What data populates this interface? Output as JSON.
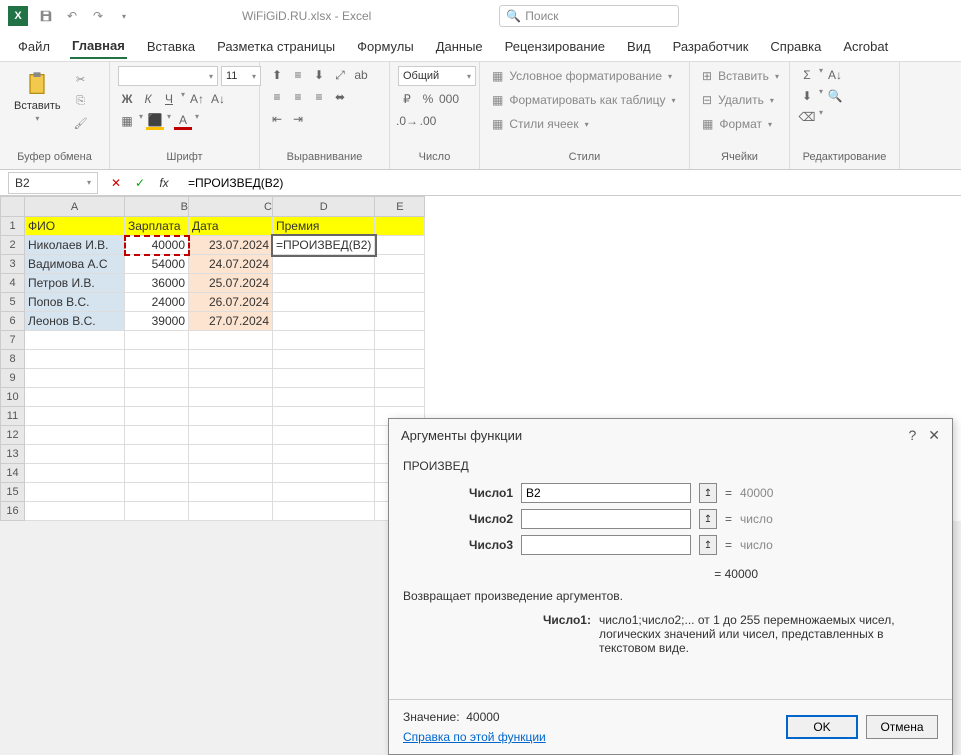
{
  "app": {
    "title": "WiFiGiD.RU.xlsx - Excel",
    "icon_letter": "X",
    "search_placeholder": "Поиск"
  },
  "menu": {
    "file": "Файл",
    "home": "Главная",
    "insert": "Вставка",
    "layout": "Разметка страницы",
    "formulas": "Формулы",
    "data": "Данные",
    "review": "Рецензирование",
    "view": "Вид",
    "developer": "Разработчик",
    "help": "Справка",
    "acrobat": "Acrobat"
  },
  "ribbon": {
    "paste": "Вставить",
    "clipboard_label": "Буфер обмена",
    "font_label": "Шрифт",
    "align_label": "Выравнивание",
    "number_label": "Число",
    "styles_label": "Стили",
    "cells_label": "Ячейки",
    "editing_label": "Редактирование",
    "font_size": "11",
    "number_format": "Общий",
    "cond_format": "Условное форматирование",
    "as_table": "Форматировать как таблицу",
    "cell_styles": "Стили ячеек",
    "insert_cells": "Вставить",
    "delete_cells": "Удалить",
    "format_cells": "Формат"
  },
  "formula_bar": {
    "name_box": "B2",
    "formula": "=ПРОИЗВЕД(B2)"
  },
  "columns": [
    "A",
    "B",
    "C",
    "D",
    "E"
  ],
  "headers": {
    "fio": "ФИО",
    "salary": "Зарплата",
    "date": "Дата",
    "bonus": "Премия"
  },
  "rows": [
    {
      "n": "Николаев И.В.",
      "s": "40000",
      "d": "23.07.2024",
      "b": "=ПРОИЗВЕД(B2)"
    },
    {
      "n": "Вадимова А.С",
      "s": "54000",
      "d": "24.07.2024",
      "b": ""
    },
    {
      "n": "Петров И.В.",
      "s": "36000",
      "d": "25.07.2024",
      "b": ""
    },
    {
      "n": "Попов В.С.",
      "s": "24000",
      "d": "26.07.2024",
      "b": ""
    },
    {
      "n": "Леонов В.С.",
      "s": "39000",
      "d": "27.07.2024",
      "b": ""
    }
  ],
  "dialog": {
    "title": "Аргументы функции",
    "func": "ПРОИЗВЕД",
    "args": [
      {
        "label": "Число1",
        "value": "B2",
        "result": "40000"
      },
      {
        "label": "Число2",
        "value": "",
        "result": "число"
      },
      {
        "label": "Число3",
        "value": "",
        "result": "число"
      }
    ],
    "eq_result": "40000",
    "description": "Возвращает произведение аргументов.",
    "arg_help_label": "Число1:",
    "arg_help_text": "число1;число2;... от 1 до 255 перемножаемых чисел, логических значений или чисел, представленных в текстовом виде.",
    "value_label": "Значение:",
    "value": "40000",
    "help_link": "Справка по этой функции",
    "ok": "OK",
    "cancel": "Отмена"
  }
}
